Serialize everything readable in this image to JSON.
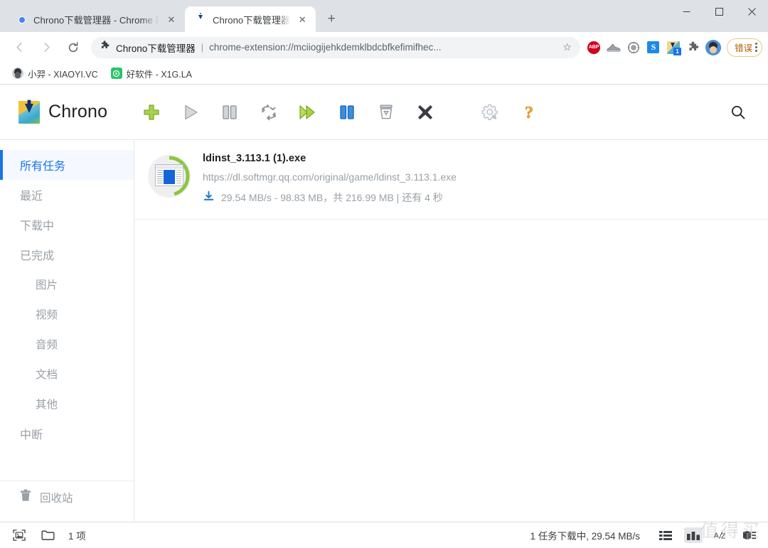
{
  "browser": {
    "tabs": [
      {
        "title": "Chrono下载管理器 - Chrome 网",
        "favicon": "chrome-icon",
        "active": false,
        "close_label": "✕"
      },
      {
        "title": "Chrono下载管理器",
        "favicon": "chrono-icon",
        "active": true,
        "close_label": "✕"
      }
    ],
    "new_tab_label": "+",
    "window_controls": {
      "minimize": "—",
      "maximize": "□",
      "close": "✕"
    },
    "nav": {
      "back": "←",
      "forward": "→",
      "reload": "⟳"
    },
    "omnibox": {
      "extension_label": "Chrono下载管理器",
      "divider": "|",
      "url": "chrome-extension://mciiogijehkdemklbdcbfkefimifhec...",
      "star": "☆"
    },
    "extensions": [
      {
        "name": "adblock-plus-icon",
        "label": "ABP"
      },
      {
        "name": "shoe-extension-icon",
        "label": ""
      },
      {
        "name": "gray-shield-icon",
        "label": ""
      },
      {
        "name": "s-extension-icon",
        "label": "S"
      },
      {
        "name": "chrono-extension-icon",
        "label": "",
        "badge": "1"
      },
      {
        "name": "puzzle-extensions-icon",
        "label": ""
      }
    ],
    "profile": {
      "name": "profile-avatar"
    },
    "error_badge": {
      "label": "错误"
    },
    "bookmarks": [
      {
        "label": "小羿 - XIAOYI.VC",
        "icon": "avatar-bookmark-icon"
      },
      {
        "label": "好软件 - X1G.LA",
        "icon": "green-square-bookmark-icon"
      }
    ]
  },
  "app": {
    "brand": "Chrono",
    "toolbar": [
      {
        "name": "add-download-button",
        "icon": "green-plus-icon",
        "title": "添加"
      },
      {
        "name": "resume-button",
        "icon": "gray-play-icon",
        "title": "开始"
      },
      {
        "name": "pause-button",
        "icon": "gray-pause-icon",
        "title": "暂停"
      },
      {
        "name": "retry-button",
        "icon": "retry-arrows-icon",
        "title": "重试"
      },
      {
        "name": "resume-all-button",
        "icon": "green-double-play-icon",
        "title": "全部开始"
      },
      {
        "name": "pause-all-button",
        "icon": "blue-pause-icon",
        "title": "全部暂停"
      },
      {
        "name": "clear-button",
        "icon": "trash-bin-icon",
        "title": "清除"
      },
      {
        "name": "cancel-button",
        "icon": "black-x-icon",
        "title": "取消"
      }
    ],
    "toolbar_right": [
      {
        "name": "settings-button",
        "icon": "gear-icon",
        "title": "设置"
      },
      {
        "name": "help-button",
        "icon": "question-mark-icon",
        "title": "帮助"
      }
    ],
    "search_label": "search-icon",
    "sidebar": {
      "items": [
        {
          "label": "所有任务",
          "active": true,
          "sub": false
        },
        {
          "label": "最近",
          "active": false,
          "sub": false
        },
        {
          "label": "下载中",
          "active": false,
          "sub": false
        },
        {
          "label": "已完成",
          "active": false,
          "sub": false
        },
        {
          "label": "图片",
          "active": false,
          "sub": true
        },
        {
          "label": "视频",
          "active": false,
          "sub": true
        },
        {
          "label": "音频",
          "active": false,
          "sub": true
        },
        {
          "label": "文档",
          "active": false,
          "sub": true
        },
        {
          "label": "其他",
          "active": false,
          "sub": true
        },
        {
          "label": "中断",
          "active": false,
          "sub": false
        }
      ],
      "trash": {
        "label": "回收站",
        "icon": "trash-icon"
      }
    },
    "downloads": [
      {
        "filename": "ldinst_3.113.1 (1).exe",
        "url": "https://dl.softmgr.qq.com/original/game/ldinst_3.113.1.exe",
        "status": "29.54 MB/s - 98.83 MB，共 216.99 MB | 还有 4 秒",
        "progress_percent": 45.5,
        "progress_color": "#8cc63f",
        "icon": "app-window-icon",
        "status_icon": "download-arrow-icon"
      }
    ],
    "statusbar": {
      "thumbnail_view_icon": "image-thumbnail-icon",
      "folder_icon": "folder-icon",
      "item_count": "1 项",
      "status_text": "1 任务下载中, 29.54 MB/s",
      "view_buttons": [
        {
          "name": "list-view-button",
          "icon": "list-view-icon",
          "active": false
        },
        {
          "name": "grid-view-button",
          "icon": "grid-view-icon",
          "active": true
        }
      ],
      "sort_buttons": [
        {
          "name": "sort-alpha-button",
          "icon": "az-sort-icon",
          "label": "A/Z"
        },
        {
          "name": "sort-order-button",
          "icon": "sort-order-icon",
          "label": ""
        }
      ]
    },
    "watermark": "值得买"
  },
  "colors": {
    "accent_blue": "#1a73e8",
    "progress_green": "#8cc63f",
    "error_orange": "#b06000",
    "text_primary": "#202124",
    "text_muted": "#9aa0a6"
  }
}
